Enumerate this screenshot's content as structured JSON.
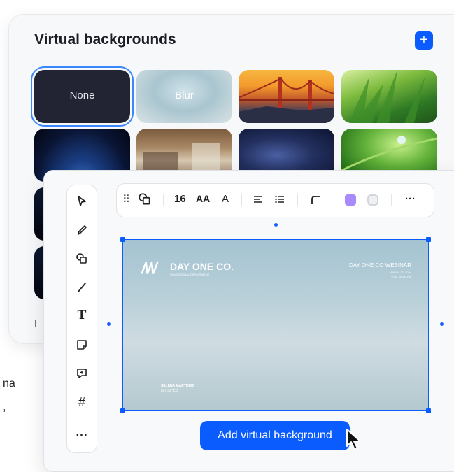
{
  "virtual_backgrounds": {
    "title": "Virtual backgrounds",
    "add_icon": "+",
    "thumbnails": [
      {
        "name": "none",
        "label": "None",
        "selected": true
      },
      {
        "name": "blur",
        "label": "Blur"
      },
      {
        "name": "golden-gate-bridge",
        "label": ""
      },
      {
        "name": "grass",
        "label": ""
      },
      {
        "name": "earth-from-space",
        "label": ""
      },
      {
        "name": "office",
        "label": ""
      },
      {
        "name": "milky-way",
        "label": ""
      },
      {
        "name": "water-drop-on-leaf",
        "label": ""
      }
    ],
    "footer_partial": "I h"
  },
  "left_partial_text": [
    "na",
    ","
  ],
  "toolbar": {
    "tools": [
      "select-icon",
      "pen-icon",
      "shapes-icon",
      "line-icon",
      "text-icon",
      "sticky-note-icon",
      "comment-icon",
      "frame-icon",
      "more-icon"
    ],
    "more_label": "···"
  },
  "format_bar": {
    "drag_handle": "⠿",
    "font_size": "16",
    "font_case": "AA",
    "text_color_label": "A",
    "more_label": "···",
    "fill_color": "#a78bfa",
    "border_color": "#d1d5db"
  },
  "slide": {
    "brand_mark": "/\\/\\/",
    "brand_name": "DAY ONE CO.",
    "brand_sub": "EDUCATIONAL DEPARTMENT",
    "event_title": "DAY ONE CO WEBINAR",
    "event_line1": "MARCH 22, 2024",
    "event_line2": "9:00 - 10:00 PM",
    "speaker_name": "SELENA MARTINEZ",
    "speaker_role": "FOUNDER"
  },
  "actions": {
    "add_background_label": "Add virtual background"
  },
  "colors": {
    "accent": "#0b5cff"
  }
}
